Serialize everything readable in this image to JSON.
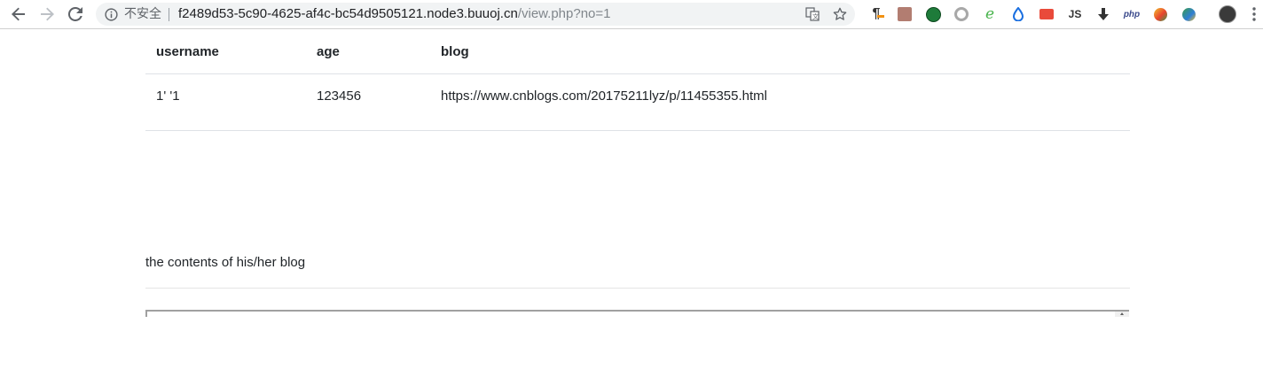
{
  "browser": {
    "security_label": "不安全",
    "url_host": "f2489d53-5c90-4625-af4c-bc54d9505121.node3.buuoj.cn",
    "url_path": "/view.php?no=1",
    "extensions": [
      {
        "name": "paragraph-icon",
        "text": "¶"
      },
      {
        "name": "pdf-icon",
        "text": ""
      },
      {
        "name": "green-circle-icon",
        "text": ""
      },
      {
        "name": "gray-ring-icon",
        "text": ""
      },
      {
        "name": "e-icon",
        "text": "e"
      },
      {
        "name": "droplet-icon",
        "text": ""
      },
      {
        "name": "red-badge-icon",
        "text": ""
      },
      {
        "name": "js-icon",
        "text": "JS"
      },
      {
        "name": "download-arrow-icon",
        "text": ""
      },
      {
        "name": "php-icon",
        "text": "php"
      },
      {
        "name": "colorful-ball-icon",
        "text": ""
      },
      {
        "name": "globe-icon",
        "text": ""
      }
    ]
  },
  "table": {
    "headers": {
      "username": "username",
      "age": "age",
      "blog": "blog"
    },
    "row": {
      "username": "1' '1",
      "age": "123456",
      "blog": "https://www.cnblogs.com/20175211lyz/p/11455355.html"
    }
  },
  "blog_section": {
    "caption": "the contents of his/her blog"
  },
  "colors": {
    "text": "#212529",
    "border": "#dee2e6",
    "omnibox": "#f1f3f4"
  }
}
